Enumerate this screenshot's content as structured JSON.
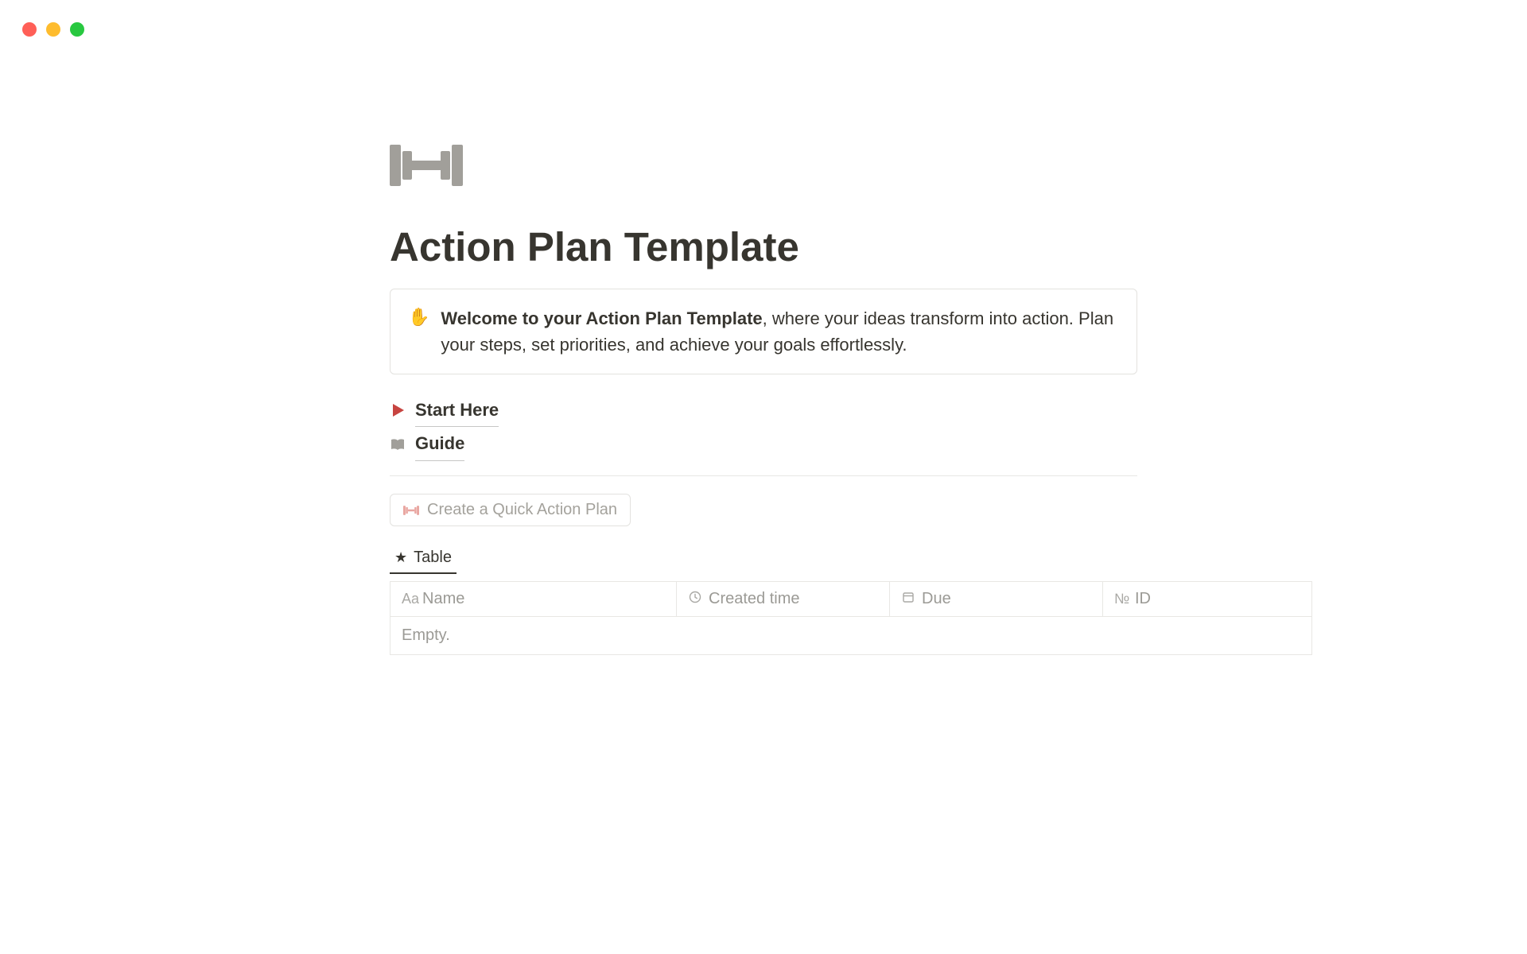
{
  "page": {
    "title": "Action Plan Template"
  },
  "callout": {
    "icon": "✋",
    "bold": "Welcome to your Action Plan Template",
    "rest": ", where your ideas transform into action. Plan your steps, set priorities, and achieve your goals effortlessly."
  },
  "links": {
    "start_here": "Start Here",
    "guide": "Guide"
  },
  "buttons": {
    "quick_action_plan": "Create a Quick Action Plan"
  },
  "views": {
    "table_tab": "Table"
  },
  "table": {
    "columns": {
      "name": "Name",
      "created": "Created time",
      "due": "Due",
      "id": "ID"
    },
    "empty_text": "Empty."
  },
  "colors": {
    "accent_red": "#c74440",
    "muted_gray": "#a19f9a"
  }
}
